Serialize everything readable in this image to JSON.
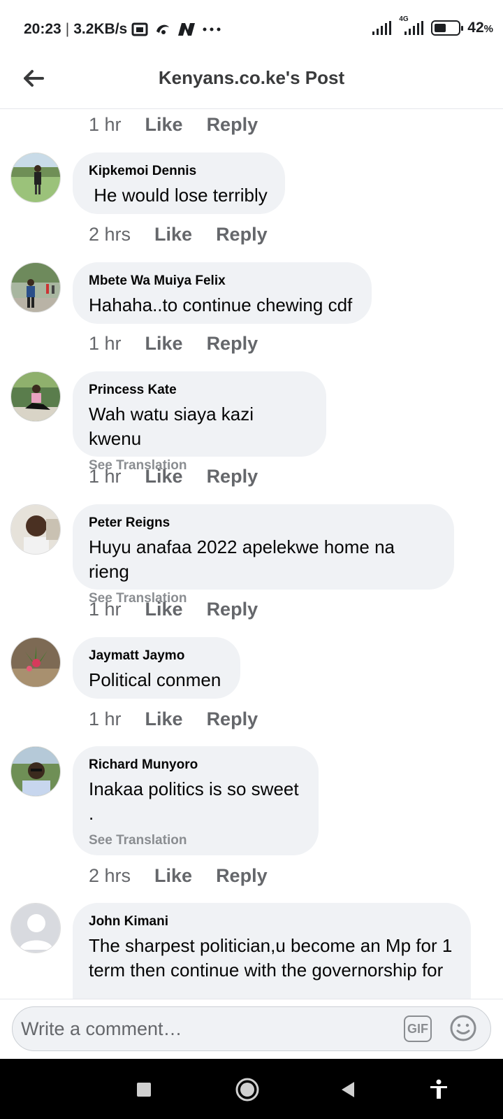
{
  "status_bar": {
    "time": "20:23",
    "speed": "3.2KB/s",
    "network": "4G",
    "battery": "42",
    "battery_unit": "%",
    "battery_level": 0.42,
    "icons": [
      "gallery-icon",
      "app-icon",
      "n-app-icon",
      "more-dots-icon",
      "signal-icon",
      "signal-4g-icon",
      "battery-icon"
    ]
  },
  "header": {
    "title": "Kenyans.co.ke's Post",
    "back_icon": "arrow-left-icon"
  },
  "top_meta": {
    "time": "1 hr",
    "like": "Like",
    "reply": "Reply"
  },
  "comments": [
    {
      "name": "Kipkemoi Dennis",
      "text": " He would lose terribly",
      "translate": "",
      "time": "2 hrs",
      "like": "Like",
      "reply": "Reply"
    },
    {
      "name": "Mbete Wa Muiya Felix",
      "text": "Hahaha..to continue chewing cdf",
      "translate": "",
      "time": "1 hr",
      "like": "Like",
      "reply": "Reply"
    },
    {
      "name": "Princess Kate",
      "text": "Wah watu siaya kazi kwenu",
      "translate": "See Translation",
      "time": "1 hr",
      "like": "Like",
      "reply": "Reply"
    },
    {
      "name": "Peter Reigns",
      "text": "Huyu anafaa 2022 apelekwe home na rieng",
      "translate": "See Translation",
      "time": "1 hr",
      "like": "Like",
      "reply": "Reply"
    },
    {
      "name": "Jaymatt Jaymo",
      "text": "Political conmen",
      "translate": "",
      "time": "1 hr",
      "like": "Like",
      "reply": "Reply"
    },
    {
      "name": "Richard Munyoro",
      "text": "Inakaa politics is so sweet\n.",
      "translate": "See Translation",
      "time": "2 hrs",
      "like": "Like",
      "reply": "Reply"
    },
    {
      "name": "John Kimani",
      "text": "The sharpest politician,u become an Mp for 1 term then continue with the governorship for",
      "translate": "",
      "time": "",
      "like": "",
      "reply": ""
    }
  ],
  "composer": {
    "placeholder": "Write a comment…",
    "gif_label": "GIF",
    "emoji_icon": "smiley-icon"
  },
  "nav_bar": {
    "icons": [
      "recents-square-icon",
      "home-circle-icon",
      "back-triangle-icon",
      "accessibility-icon"
    ]
  },
  "colors": {
    "bubble": "#f0f2f5",
    "meta_text": "#65676b",
    "translate_text": "#8a8d91",
    "title_text": "#3a3b3c"
  }
}
